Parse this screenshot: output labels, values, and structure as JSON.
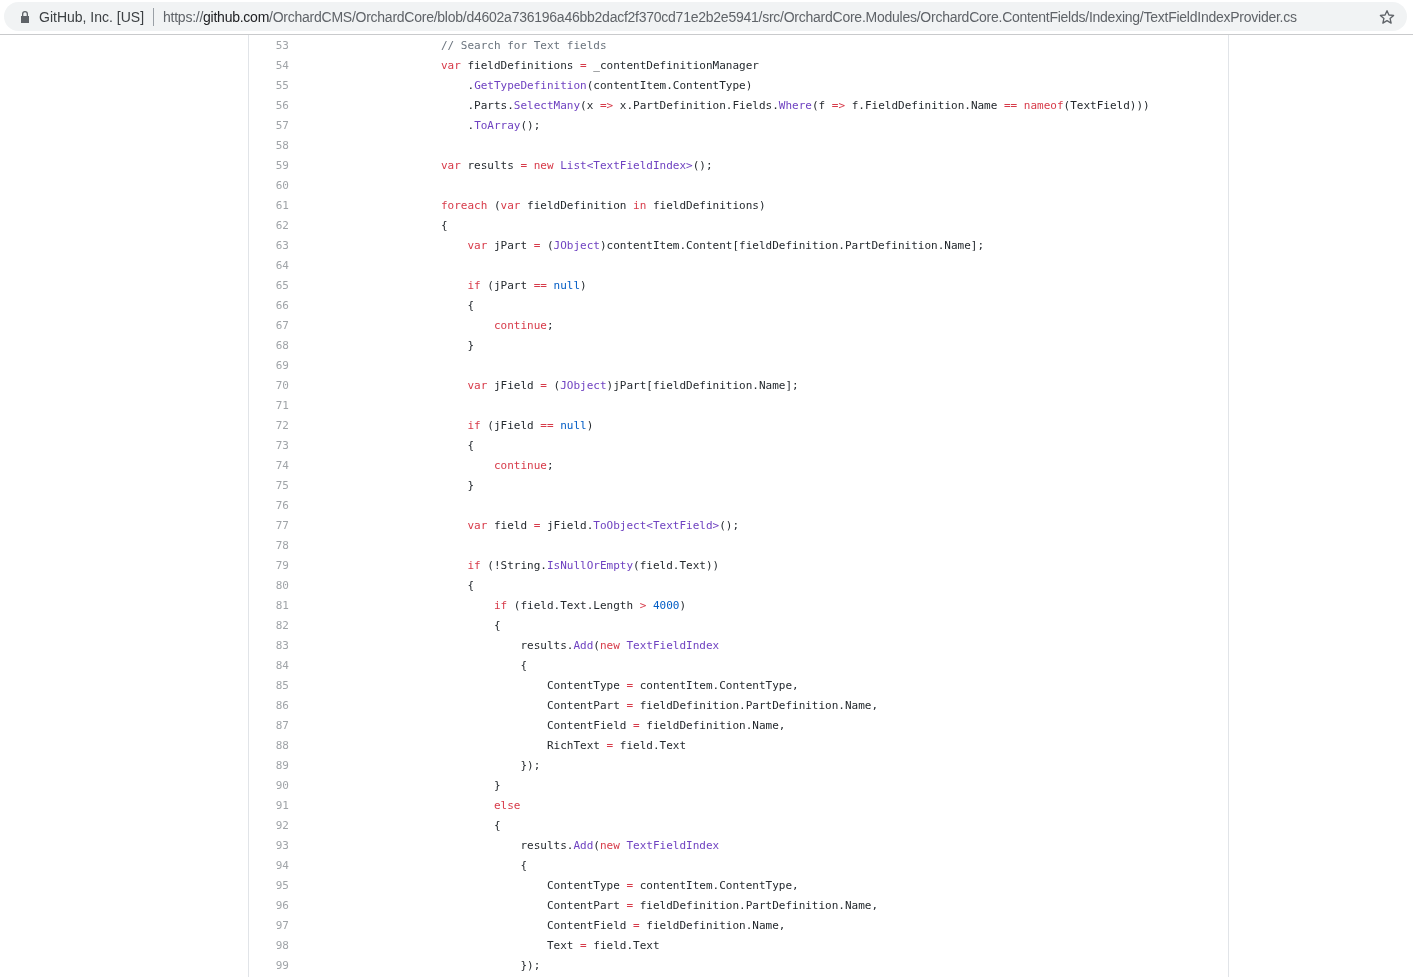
{
  "address_bar": {
    "site_identity": "GitHub, Inc. [US]",
    "url": {
      "scheme": "https://",
      "host": "github.com",
      "path": "/OrchardCMS/OrchardCore/blob/d4602a736196a46bb2dacf2f370cd71e2b2e5941/src/OrchardCore.Modules/OrchardCore.ContentFields/Indexing/TextFieldIndexProvider.cs"
    }
  },
  "code": {
    "lines": [
      {
        "number": "53",
        "tokens": [
          {
            "kind": "comment",
            "text": "// Search for Text fields"
          }
        ]
      },
      {
        "number": "54",
        "tokens": [
          {
            "kind": "keyword",
            "text": "var"
          },
          {
            "kind": "plain",
            "text": " fieldDefinitions "
          },
          {
            "kind": "operator",
            "text": "="
          },
          {
            "kind": "plain",
            "text": " _contentDefinitionManager"
          }
        ]
      },
      {
        "number": "55",
        "tokens": [
          {
            "kind": "plain",
            "text": "    ."
          },
          {
            "kind": "method",
            "text": "GetTypeDefinition"
          },
          {
            "kind": "plain",
            "text": "(contentItem.ContentType)"
          }
        ]
      },
      {
        "number": "56",
        "tokens": [
          {
            "kind": "plain",
            "text": "    .Parts."
          },
          {
            "kind": "method",
            "text": "SelectMany"
          },
          {
            "kind": "plain",
            "text": "(x "
          },
          {
            "kind": "operator",
            "text": "=>"
          },
          {
            "kind": "plain",
            "text": " x.PartDefinition.Fields."
          },
          {
            "kind": "method",
            "text": "Where"
          },
          {
            "kind": "plain",
            "text": "(f "
          },
          {
            "kind": "operator",
            "text": "=>"
          },
          {
            "kind": "plain",
            "text": " f.FieldDefinition.Name "
          },
          {
            "kind": "operator",
            "text": "=="
          },
          {
            "kind": "keyword",
            "text": " nameof"
          },
          {
            "kind": "plain",
            "text": "(TextField)))"
          }
        ]
      },
      {
        "number": "57",
        "tokens": [
          {
            "kind": "plain",
            "text": "    ."
          },
          {
            "kind": "method",
            "text": "ToArray"
          },
          {
            "kind": "plain",
            "text": "();"
          }
        ]
      },
      {
        "number": "58"
      },
      {
        "number": "59",
        "tokens": [
          {
            "kind": "keyword",
            "text": "var"
          },
          {
            "kind": "plain",
            "text": " results "
          },
          {
            "kind": "operator",
            "text": "="
          },
          {
            "kind": "keyword",
            "text": " new"
          },
          {
            "kind": "type",
            "text": " List<TextFieldIndex>"
          },
          {
            "kind": "plain",
            "text": "();"
          }
        ]
      },
      {
        "number": "60"
      },
      {
        "number": "61",
        "tokens": [
          {
            "kind": "keyword",
            "text": "foreach"
          },
          {
            "kind": "plain",
            "text": " ("
          },
          {
            "kind": "keyword",
            "text": "var"
          },
          {
            "kind": "plain",
            "text": " fieldDefinition "
          },
          {
            "kind": "keyword",
            "text": "in"
          },
          {
            "kind": "plain",
            "text": " fieldDefinitions)"
          }
        ]
      },
      {
        "number": "62",
        "tokens": [
          {
            "kind": "plain",
            "text": "{"
          }
        ]
      },
      {
        "number": "63",
        "tokens": [
          {
            "kind": "keyword",
            "text": "    var"
          },
          {
            "kind": "plain",
            "text": " jPart "
          },
          {
            "kind": "operator",
            "text": "="
          },
          {
            "kind": "plain",
            "text": " ("
          },
          {
            "kind": "type",
            "text": "JObject"
          },
          {
            "kind": "plain",
            "text": ")contentItem.Content[fieldDefinition.PartDefinition.Name];"
          }
        ]
      },
      {
        "number": "64"
      },
      {
        "number": "65",
        "tokens": [
          {
            "kind": "keyword",
            "text": "    if"
          },
          {
            "kind": "plain",
            "text": " (jPart "
          },
          {
            "kind": "operator",
            "text": "=="
          },
          {
            "kind": "literal",
            "text": " null"
          },
          {
            "kind": "plain",
            "text": ")"
          }
        ]
      },
      {
        "number": "66",
        "tokens": [
          {
            "kind": "plain",
            "text": "    {"
          }
        ]
      },
      {
        "number": "67",
        "tokens": [
          {
            "kind": "keyword",
            "text": "        continue"
          },
          {
            "kind": "plain",
            "text": ";"
          }
        ]
      },
      {
        "number": "68",
        "tokens": [
          {
            "kind": "plain",
            "text": "    }"
          }
        ]
      },
      {
        "number": "69"
      },
      {
        "number": "70",
        "tokens": [
          {
            "kind": "keyword",
            "text": "    var"
          },
          {
            "kind": "plain",
            "text": " jField "
          },
          {
            "kind": "operator",
            "text": "="
          },
          {
            "kind": "plain",
            "text": " ("
          },
          {
            "kind": "type",
            "text": "JObject"
          },
          {
            "kind": "plain",
            "text": ")jPart[fieldDefinition.Name];"
          }
        ]
      },
      {
        "number": "71"
      },
      {
        "number": "72",
        "tokens": [
          {
            "kind": "keyword",
            "text": "    if"
          },
          {
            "kind": "plain",
            "text": " (jField "
          },
          {
            "kind": "operator",
            "text": "=="
          },
          {
            "kind": "literal",
            "text": " null"
          },
          {
            "kind": "plain",
            "text": ")"
          }
        ]
      },
      {
        "number": "73",
        "tokens": [
          {
            "kind": "plain",
            "text": "    {"
          }
        ]
      },
      {
        "number": "74",
        "tokens": [
          {
            "kind": "keyword",
            "text": "        continue"
          },
          {
            "kind": "plain",
            "text": ";"
          }
        ]
      },
      {
        "number": "75",
        "tokens": [
          {
            "kind": "plain",
            "text": "    }"
          }
        ]
      },
      {
        "number": "76"
      },
      {
        "number": "77",
        "tokens": [
          {
            "kind": "keyword",
            "text": "    var"
          },
          {
            "kind": "plain",
            "text": " field "
          },
          {
            "kind": "operator",
            "text": "="
          },
          {
            "kind": "plain",
            "text": " jField."
          },
          {
            "kind": "method",
            "text": "ToObject"
          },
          {
            "kind": "type",
            "text": "<TextField>"
          },
          {
            "kind": "plain",
            "text": "();"
          }
        ]
      },
      {
        "number": "78"
      },
      {
        "number": "79",
        "tokens": [
          {
            "kind": "keyword",
            "text": "    if"
          },
          {
            "kind": "plain",
            "text": " (!String."
          },
          {
            "kind": "method",
            "text": "IsNullOrEmpty"
          },
          {
            "kind": "plain",
            "text": "(field.Text))"
          }
        ]
      },
      {
        "number": "80",
        "tokens": [
          {
            "kind": "plain",
            "text": "    {"
          }
        ]
      },
      {
        "number": "81",
        "tokens": [
          {
            "kind": "keyword",
            "text": "        if"
          },
          {
            "kind": "plain",
            "text": " (field.Text.Length "
          },
          {
            "kind": "operator",
            "text": ">"
          },
          {
            "kind": "literal",
            "text": " 4000"
          },
          {
            "kind": "plain",
            "text": ")"
          }
        ]
      },
      {
        "number": "82",
        "tokens": [
          {
            "kind": "plain",
            "text": "        {"
          }
        ]
      },
      {
        "number": "83",
        "tokens": [
          {
            "kind": "plain",
            "text": "            results."
          },
          {
            "kind": "method",
            "text": "Add"
          },
          {
            "kind": "plain",
            "text": "("
          },
          {
            "kind": "keyword",
            "text": "new"
          },
          {
            "kind": "type",
            "text": " TextFieldIndex"
          }
        ]
      },
      {
        "number": "84",
        "tokens": [
          {
            "kind": "plain",
            "text": "            {"
          }
        ]
      },
      {
        "number": "85",
        "tokens": [
          {
            "kind": "plain",
            "text": "                ContentType "
          },
          {
            "kind": "operator",
            "text": "="
          },
          {
            "kind": "plain",
            "text": " contentItem.ContentType,"
          }
        ]
      },
      {
        "number": "86",
        "tokens": [
          {
            "kind": "plain",
            "text": "                ContentPart "
          },
          {
            "kind": "operator",
            "text": "="
          },
          {
            "kind": "plain",
            "text": " fieldDefinition.PartDefinition.Name,"
          }
        ]
      },
      {
        "number": "87",
        "tokens": [
          {
            "kind": "plain",
            "text": "                ContentField "
          },
          {
            "kind": "operator",
            "text": "="
          },
          {
            "kind": "plain",
            "text": " fieldDefinition.Name,"
          }
        ]
      },
      {
        "number": "88",
        "tokens": [
          {
            "kind": "plain",
            "text": "                RichText "
          },
          {
            "kind": "operator",
            "text": "="
          },
          {
            "kind": "plain",
            "text": " field.Text"
          }
        ]
      },
      {
        "number": "89",
        "tokens": [
          {
            "kind": "plain",
            "text": "            });"
          }
        ]
      },
      {
        "number": "90",
        "tokens": [
          {
            "kind": "plain",
            "text": "        }"
          }
        ]
      },
      {
        "number": "91",
        "tokens": [
          {
            "kind": "keyword",
            "text": "        else"
          }
        ]
      },
      {
        "number": "92",
        "tokens": [
          {
            "kind": "plain",
            "text": "        {"
          }
        ]
      },
      {
        "number": "93",
        "tokens": [
          {
            "kind": "plain",
            "text": "            results."
          },
          {
            "kind": "method",
            "text": "Add"
          },
          {
            "kind": "plain",
            "text": "("
          },
          {
            "kind": "keyword",
            "text": "new"
          },
          {
            "kind": "type",
            "text": " TextFieldIndex"
          }
        ]
      },
      {
        "number": "94",
        "tokens": [
          {
            "kind": "plain",
            "text": "            {"
          }
        ]
      },
      {
        "number": "95",
        "tokens": [
          {
            "kind": "plain",
            "text": "                ContentType "
          },
          {
            "kind": "operator",
            "text": "="
          },
          {
            "kind": "plain",
            "text": " contentItem.ContentType,"
          }
        ]
      },
      {
        "number": "96",
        "tokens": [
          {
            "kind": "plain",
            "text": "                ContentPart "
          },
          {
            "kind": "operator",
            "text": "="
          },
          {
            "kind": "plain",
            "text": " fieldDefinition.PartDefinition.Name,"
          }
        ]
      },
      {
        "number": "97",
        "tokens": [
          {
            "kind": "plain",
            "text": "                ContentField "
          },
          {
            "kind": "operator",
            "text": "="
          },
          {
            "kind": "plain",
            "text": " fieldDefinition.Name,"
          }
        ]
      },
      {
        "number": "98",
        "tokens": [
          {
            "kind": "plain",
            "text": "                Text "
          },
          {
            "kind": "operator",
            "text": "="
          },
          {
            "kind": "plain",
            "text": " field.Text"
          }
        ]
      },
      {
        "number": "99",
        "tokens": [
          {
            "kind": "plain",
            "text": "            });"
          }
        ]
      }
    ]
  }
}
